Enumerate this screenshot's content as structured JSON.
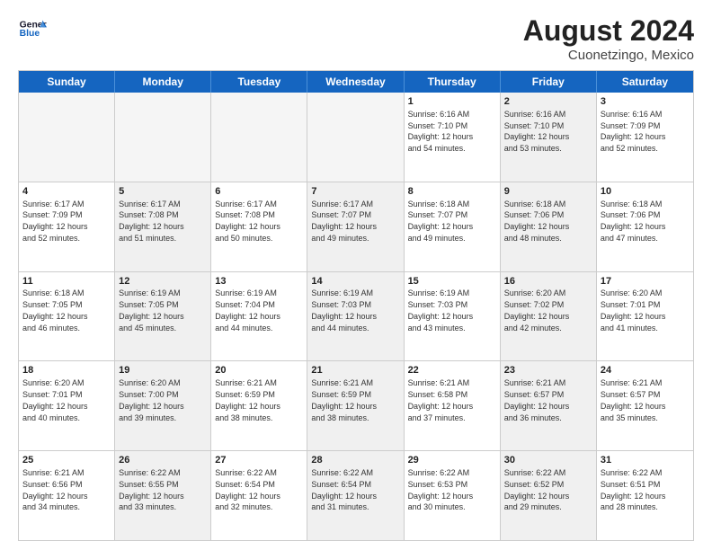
{
  "header": {
    "logo_line1": "General",
    "logo_line2": "Blue",
    "title": "August 2024",
    "subtitle": "Cuonetzingo, Mexico"
  },
  "weekdays": [
    "Sunday",
    "Monday",
    "Tuesday",
    "Wednesday",
    "Thursday",
    "Friday",
    "Saturday"
  ],
  "rows": [
    [
      {
        "day": "",
        "text": "",
        "empty": true
      },
      {
        "day": "",
        "text": "",
        "empty": true
      },
      {
        "day": "",
        "text": "",
        "empty": true
      },
      {
        "day": "",
        "text": "",
        "empty": true
      },
      {
        "day": "1",
        "text": "Sunrise: 6:16 AM\nSunset: 7:10 PM\nDaylight: 12 hours\nand 54 minutes.",
        "shaded": false
      },
      {
        "day": "2",
        "text": "Sunrise: 6:16 AM\nSunset: 7:10 PM\nDaylight: 12 hours\nand 53 minutes.",
        "shaded": true
      },
      {
        "day": "3",
        "text": "Sunrise: 6:16 AM\nSunset: 7:09 PM\nDaylight: 12 hours\nand 52 minutes.",
        "shaded": false
      }
    ],
    [
      {
        "day": "4",
        "text": "Sunrise: 6:17 AM\nSunset: 7:09 PM\nDaylight: 12 hours\nand 52 minutes.",
        "shaded": false
      },
      {
        "day": "5",
        "text": "Sunrise: 6:17 AM\nSunset: 7:08 PM\nDaylight: 12 hours\nand 51 minutes.",
        "shaded": true
      },
      {
        "day": "6",
        "text": "Sunrise: 6:17 AM\nSunset: 7:08 PM\nDaylight: 12 hours\nand 50 minutes.",
        "shaded": false
      },
      {
        "day": "7",
        "text": "Sunrise: 6:17 AM\nSunset: 7:07 PM\nDaylight: 12 hours\nand 49 minutes.",
        "shaded": true
      },
      {
        "day": "8",
        "text": "Sunrise: 6:18 AM\nSunset: 7:07 PM\nDaylight: 12 hours\nand 49 minutes.",
        "shaded": false
      },
      {
        "day": "9",
        "text": "Sunrise: 6:18 AM\nSunset: 7:06 PM\nDaylight: 12 hours\nand 48 minutes.",
        "shaded": true
      },
      {
        "day": "10",
        "text": "Sunrise: 6:18 AM\nSunset: 7:06 PM\nDaylight: 12 hours\nand 47 minutes.",
        "shaded": false
      }
    ],
    [
      {
        "day": "11",
        "text": "Sunrise: 6:18 AM\nSunset: 7:05 PM\nDaylight: 12 hours\nand 46 minutes.",
        "shaded": false
      },
      {
        "day": "12",
        "text": "Sunrise: 6:19 AM\nSunset: 7:05 PM\nDaylight: 12 hours\nand 45 minutes.",
        "shaded": true
      },
      {
        "day": "13",
        "text": "Sunrise: 6:19 AM\nSunset: 7:04 PM\nDaylight: 12 hours\nand 44 minutes.",
        "shaded": false
      },
      {
        "day": "14",
        "text": "Sunrise: 6:19 AM\nSunset: 7:03 PM\nDaylight: 12 hours\nand 44 minutes.",
        "shaded": true
      },
      {
        "day": "15",
        "text": "Sunrise: 6:19 AM\nSunset: 7:03 PM\nDaylight: 12 hours\nand 43 minutes.",
        "shaded": false
      },
      {
        "day": "16",
        "text": "Sunrise: 6:20 AM\nSunset: 7:02 PM\nDaylight: 12 hours\nand 42 minutes.",
        "shaded": true
      },
      {
        "day": "17",
        "text": "Sunrise: 6:20 AM\nSunset: 7:01 PM\nDaylight: 12 hours\nand 41 minutes.",
        "shaded": false
      }
    ],
    [
      {
        "day": "18",
        "text": "Sunrise: 6:20 AM\nSunset: 7:01 PM\nDaylight: 12 hours\nand 40 minutes.",
        "shaded": false
      },
      {
        "day": "19",
        "text": "Sunrise: 6:20 AM\nSunset: 7:00 PM\nDaylight: 12 hours\nand 39 minutes.",
        "shaded": true
      },
      {
        "day": "20",
        "text": "Sunrise: 6:21 AM\nSunset: 6:59 PM\nDaylight: 12 hours\nand 38 minutes.",
        "shaded": false
      },
      {
        "day": "21",
        "text": "Sunrise: 6:21 AM\nSunset: 6:59 PM\nDaylight: 12 hours\nand 38 minutes.",
        "shaded": true
      },
      {
        "day": "22",
        "text": "Sunrise: 6:21 AM\nSunset: 6:58 PM\nDaylight: 12 hours\nand 37 minutes.",
        "shaded": false
      },
      {
        "day": "23",
        "text": "Sunrise: 6:21 AM\nSunset: 6:57 PM\nDaylight: 12 hours\nand 36 minutes.",
        "shaded": true
      },
      {
        "day": "24",
        "text": "Sunrise: 6:21 AM\nSunset: 6:57 PM\nDaylight: 12 hours\nand 35 minutes.",
        "shaded": false
      }
    ],
    [
      {
        "day": "25",
        "text": "Sunrise: 6:21 AM\nSunset: 6:56 PM\nDaylight: 12 hours\nand 34 minutes.",
        "shaded": false
      },
      {
        "day": "26",
        "text": "Sunrise: 6:22 AM\nSunset: 6:55 PM\nDaylight: 12 hours\nand 33 minutes.",
        "shaded": true
      },
      {
        "day": "27",
        "text": "Sunrise: 6:22 AM\nSunset: 6:54 PM\nDaylight: 12 hours\nand 32 minutes.",
        "shaded": false
      },
      {
        "day": "28",
        "text": "Sunrise: 6:22 AM\nSunset: 6:54 PM\nDaylight: 12 hours\nand 31 minutes.",
        "shaded": true
      },
      {
        "day": "29",
        "text": "Sunrise: 6:22 AM\nSunset: 6:53 PM\nDaylight: 12 hours\nand 30 minutes.",
        "shaded": false
      },
      {
        "day": "30",
        "text": "Sunrise: 6:22 AM\nSunset: 6:52 PM\nDaylight: 12 hours\nand 29 minutes.",
        "shaded": true
      },
      {
        "day": "31",
        "text": "Sunrise: 6:22 AM\nSunset: 6:51 PM\nDaylight: 12 hours\nand 28 minutes.",
        "shaded": false
      }
    ]
  ]
}
